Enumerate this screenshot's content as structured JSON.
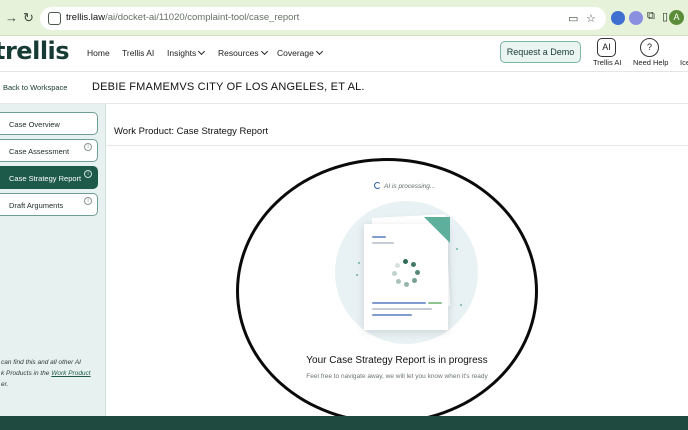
{
  "browser": {
    "back": "→",
    "reload": "↻",
    "url_domain": "trellis.law",
    "url_path": "/ai/docket-ai/11020/complaint-tool/case_report",
    "profile_initial": "A"
  },
  "header": {
    "logo": "trellis",
    "nav": [
      "Home",
      "Trellis AI",
      "Insights",
      "Resources",
      "Coverage"
    ],
    "demo_button": "Request a Demo",
    "trellis_ai_label": "Trellis AI",
    "help_label": "Need Help",
    "help_icon_glyph": "?",
    "ai_icon_glyph": "AI",
    "cut_label": "Ice"
  },
  "case": {
    "back_label": "Back to Workspace",
    "title": "DEBIE FMAMEMVS CITY OF LOS ANGELES, ET AL."
  },
  "sidebar": {
    "items": [
      {
        "label": "Case Overview"
      },
      {
        "label": "Case Assessment"
      },
      {
        "label": "Case Strategy Report"
      },
      {
        "label": "Draft Arguments"
      }
    ],
    "note_prefix": "can find this and all other AI",
    "note_middle": "k Products in the ",
    "note_link": "Work Product",
    "note_suffix": "er."
  },
  "main": {
    "title": "Work Product: Case Strategy Report",
    "processing": "AI is processing...",
    "progress_title": "Your Case Strategy Report is in progress",
    "progress_sub": "Feel free to navigate away, we will let you know when it's ready"
  },
  "colors": {
    "brand_green": "#1d5a4a",
    "accent_teal": "#5faf9d",
    "browser_bar": "#e6f2d9"
  },
  "icons": {
    "help": "question-icon",
    "ai": "ai-icon",
    "info": "info-icon",
    "loader": "spinner-icon"
  }
}
